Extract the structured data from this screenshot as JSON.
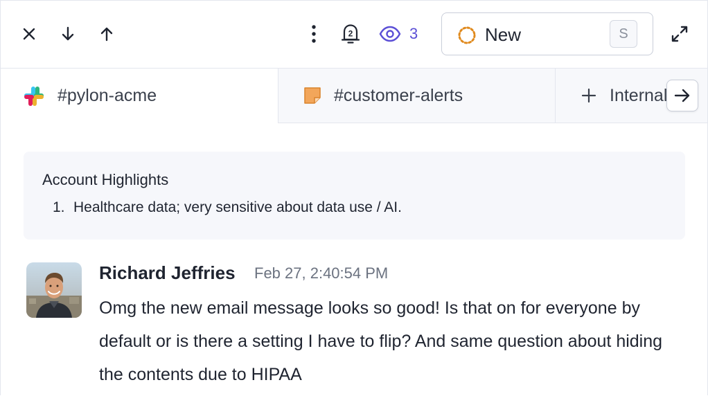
{
  "toolbar": {
    "icons": [
      "close-icon",
      "arrow-down-icon",
      "arrow-up-icon",
      "more-vertical-icon",
      "bell-icon",
      "eye-icon",
      "expand-icon"
    ],
    "notification_badge": "2",
    "watchers_count": "3",
    "status": {
      "label": "New",
      "shortcut": "S"
    },
    "colors": {
      "accent": "#5b4fd6",
      "status_ring": "#e08a1e"
    }
  },
  "tabs": [
    {
      "label": "#pylon-acme",
      "icon": "slack-icon",
      "active": true
    },
    {
      "label": "#customer-alerts",
      "icon": "note-icon",
      "active": false
    },
    {
      "label": "Internal",
      "icon": "plus-icon",
      "active": false
    }
  ],
  "highlights": {
    "title": "Account Highlights",
    "items": [
      {
        "number": "1.",
        "text": "Healthcare data; very sensitive about data use / AI."
      }
    ]
  },
  "message": {
    "author": "Richard Jeffries",
    "timestamp": "Feb 27, 2:40:54 PM",
    "body": "Omg the new email message looks so good! Is that on for everyone by default or is there a setting I have to flip? And same question about hiding the contents due to HIPAA"
  }
}
